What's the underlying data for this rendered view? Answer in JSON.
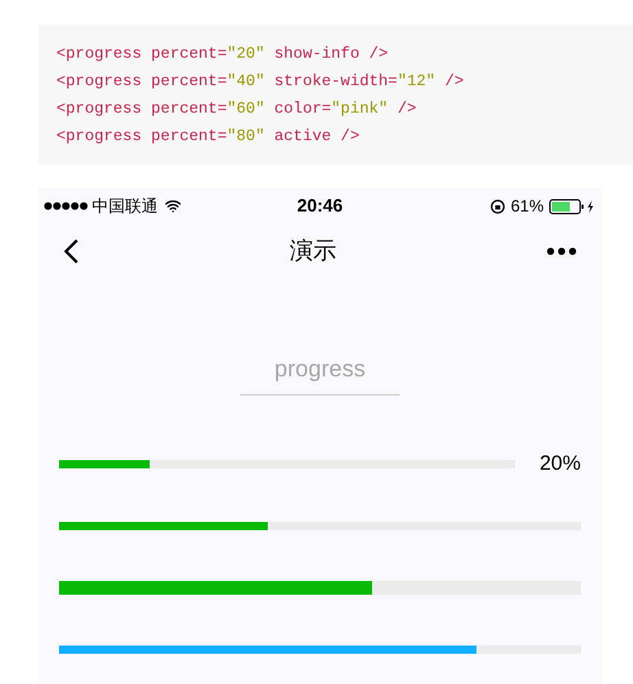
{
  "code_lines": [
    {
      "tokens": [
        {
          "text": "<progress percent=",
          "kind": "tag"
        },
        {
          "text": "\"20\"",
          "kind": "string"
        },
        {
          "text": " show-info />",
          "kind": "tag"
        }
      ]
    },
    {
      "tokens": [
        {
          "text": "<progress percent=",
          "kind": "tag"
        },
        {
          "text": "\"40\"",
          "kind": "string"
        },
        {
          "text": " stroke-width=",
          "kind": "tag"
        },
        {
          "text": "\"12\"",
          "kind": "string"
        },
        {
          "text": " />",
          "kind": "tag"
        }
      ]
    },
    {
      "tokens": [
        {
          "text": "<progress percent=",
          "kind": "tag"
        },
        {
          "text": "\"60\"",
          "kind": "string"
        },
        {
          "text": " color=",
          "kind": "tag"
        },
        {
          "text": "\"pink\"",
          "kind": "string"
        },
        {
          "text": " />",
          "kind": "tag"
        }
      ]
    },
    {
      "tokens": [
        {
          "text": "<progress percent=",
          "kind": "tag"
        },
        {
          "text": "\"80\"",
          "kind": "string"
        },
        {
          "text": " active />",
          "kind": "tag"
        }
      ]
    }
  ],
  "status_bar": {
    "carrier": "中国联通",
    "time": "20:46",
    "battery": "61%"
  },
  "nav": {
    "title": "演示"
  },
  "search": {
    "placeholder": "progress"
  },
  "bars": [
    {
      "level": 0.2,
      "color": "#09bb07",
      "kind": "thin",
      "reading": "20%"
    },
    {
      "level": 0.4,
      "color": "#09bb07",
      "kind": "thin"
    },
    {
      "level": 0.6,
      "color": "#09bb07",
      "kind": "thick"
    },
    {
      "level": 0.8,
      "color": "#10aeff",
      "kind": "thin"
    }
  ]
}
